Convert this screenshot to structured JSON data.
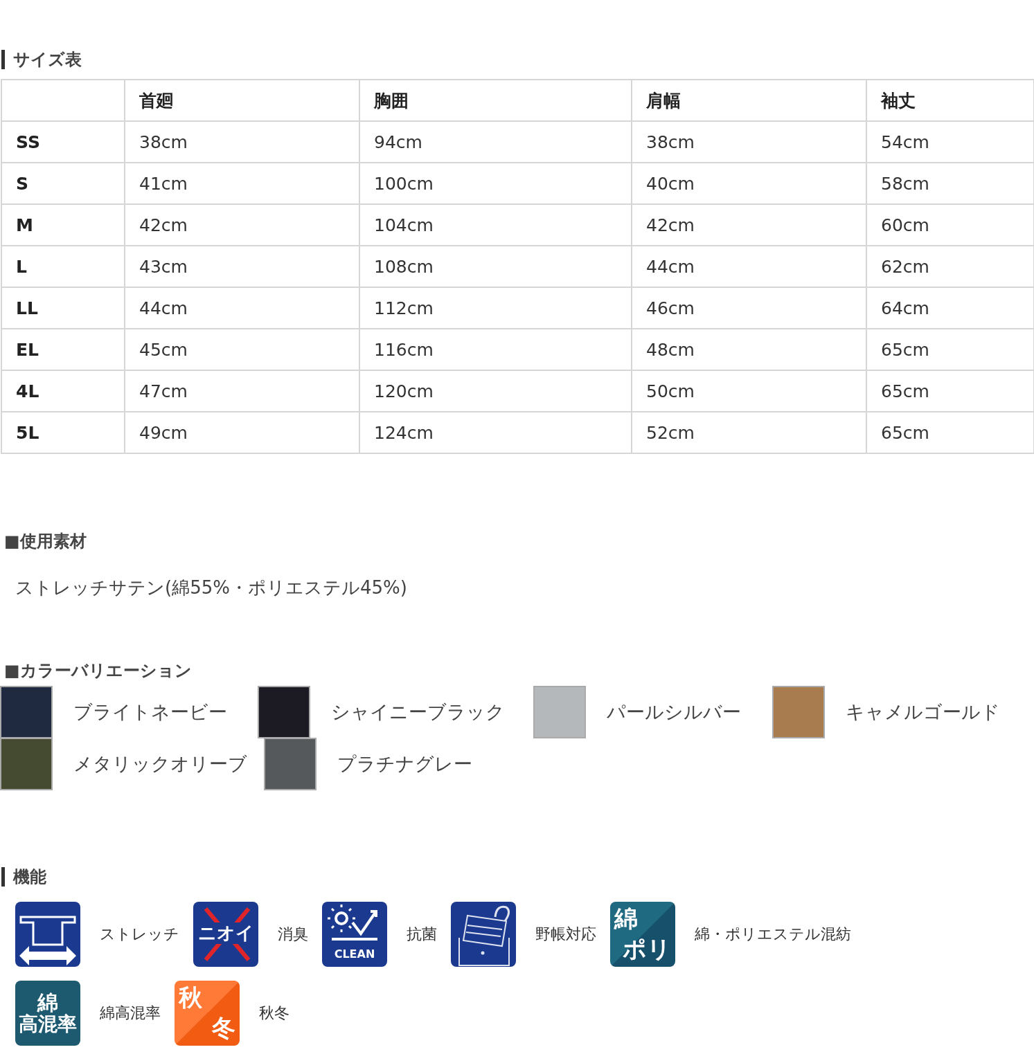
{
  "size_table": {
    "title": "サイズ表",
    "columns": [
      "",
      "首廻",
      "胸囲",
      "肩幅",
      "袖丈"
    ],
    "rows": [
      [
        "SS",
        "38cm",
        "94cm",
        "38cm",
        "54cm"
      ],
      [
        "S",
        "41cm",
        "100cm",
        "40cm",
        "58cm"
      ],
      [
        "M",
        "42cm",
        "104cm",
        "42cm",
        "60cm"
      ],
      [
        "L",
        "43cm",
        "108cm",
        "44cm",
        "62cm"
      ],
      [
        "LL",
        "44cm",
        "112cm",
        "46cm",
        "64cm"
      ],
      [
        "EL",
        "45cm",
        "116cm",
        "48cm",
        "65cm"
      ],
      [
        "4L",
        "47cm",
        "120cm",
        "50cm",
        "65cm"
      ],
      [
        "5L",
        "49cm",
        "124cm",
        "52cm",
        "65cm"
      ]
    ]
  },
  "material": {
    "title": "■使用素材",
    "text": "ストレッチサテン(綿55%・ポリエステル45%)"
  },
  "colors": {
    "title": "■カラーバリエーション",
    "items": [
      {
        "name": "ブライトネービー",
        "color": "#1f2940"
      },
      {
        "name": "シャイニーブラック",
        "color": "#1c1b24"
      },
      {
        "name": "パールシルバー",
        "color": "#b4b8bb"
      },
      {
        "name": "キャメルゴールド",
        "color": "#a87c4f"
      },
      {
        "name": "メタリックオリーブ",
        "color": "#454b30"
      },
      {
        "name": "プラチナグレー",
        "color": "#56595c"
      }
    ]
  },
  "features": {
    "title": "機能",
    "items": [
      {
        "kind": "stretch",
        "label": "ストレッチ"
      },
      {
        "kind": "odor",
        "label": "消臭",
        "icon_text": [
          "ニオイ"
        ]
      },
      {
        "kind": "clean",
        "label": "抗菌",
        "icon_text": [
          "CLEAN"
        ]
      },
      {
        "kind": "notebook",
        "label": "野帳対応"
      },
      {
        "kind": "split-teal",
        "label": "綿・ポリエステル混紡",
        "icon_text": [
          "綿",
          "ポリ"
        ]
      },
      {
        "kind": "teal",
        "label": "綿高混率",
        "icon_text": [
          "綿",
          "高混率"
        ]
      },
      {
        "kind": "split-orange",
        "label": "秋冬",
        "icon_text": [
          "秋",
          "冬"
        ]
      }
    ]
  }
}
